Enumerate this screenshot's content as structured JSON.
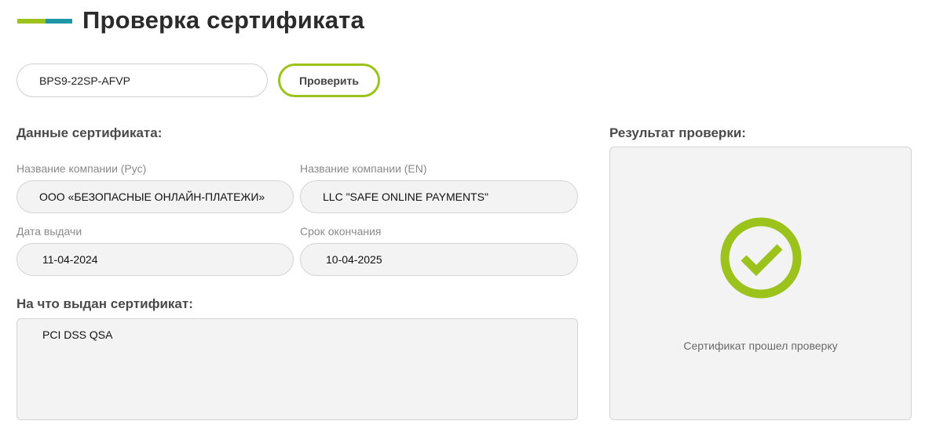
{
  "header": {
    "title": "Проверка сертификата"
  },
  "search": {
    "value": "BPS9-22SP-AFVP",
    "button_label": "Проверить"
  },
  "details": {
    "section_title": "Данные сертификата:",
    "company_ru": {
      "label": "Название компании (Рус)",
      "value": "ООО «БЕЗОПАСНЫЕ ОНЛАЙН-ПЛАТЕЖИ»"
    },
    "company_en": {
      "label": "Название компании (EN)",
      "value": "LLC \"SAFE ONLINE PAYMENTS\""
    },
    "issue_date": {
      "label": "Дата выдачи",
      "value": "11-04-2024"
    },
    "expiry_date": {
      "label": "Срок окончания",
      "value": "10-04-2025"
    },
    "scope": {
      "section_title": "На что выдан сертификат:",
      "value": "PCI DSS QSA"
    }
  },
  "result": {
    "section_title": "Результат проверки:",
    "icon": "check-circle-icon",
    "status_text": "Сертификат прошел проверку",
    "status_color": "#9bc31c"
  },
  "colors": {
    "accent_green": "#9bc31c",
    "accent_teal": "#1e98a6"
  }
}
